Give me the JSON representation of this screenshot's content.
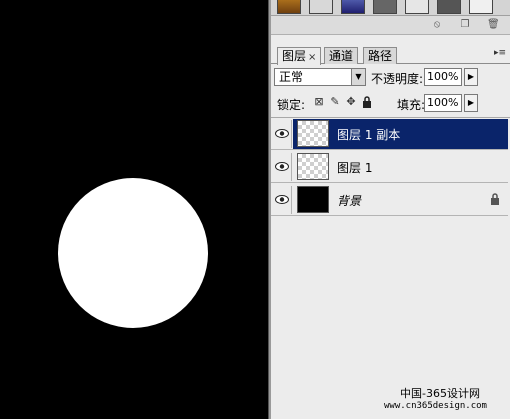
{
  "tabs": [
    {
      "label": "图层",
      "close": "×"
    },
    {
      "label": "通道"
    },
    {
      "label": "路径"
    }
  ],
  "blend": {
    "mode": "正常",
    "opacity_label": "不透明度:",
    "opacity_value": "100%"
  },
  "lock": {
    "label": "锁定:",
    "fill_label": "填充:",
    "fill_value": "100%"
  },
  "layers": [
    {
      "name": "图层 1 副本",
      "selected": true,
      "thumbnail": "transparent"
    },
    {
      "name": "图层 1",
      "selected": false,
      "thumbnail": "transparent"
    },
    {
      "name": "背景",
      "selected": false,
      "thumbnail": "black",
      "locked": true
    }
  ],
  "watermark": {
    "title": "中国-365设计网",
    "url": "www.cn365design.com"
  },
  "colors": {
    "selection": "#0a246a",
    "panel": "#ececec",
    "canvas": "#000000"
  }
}
